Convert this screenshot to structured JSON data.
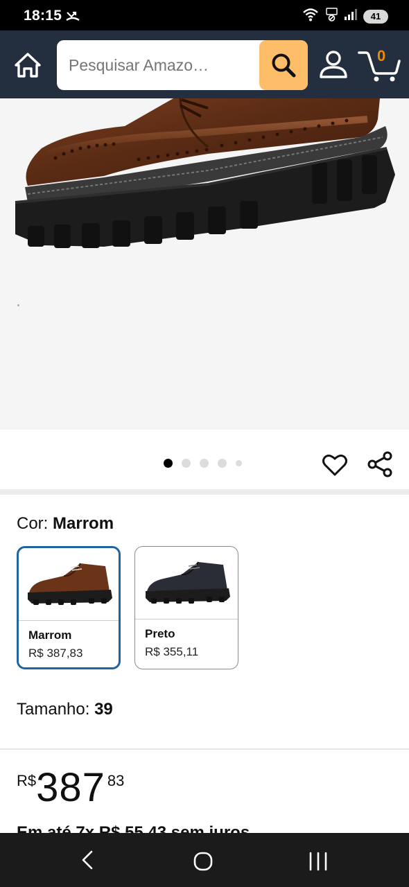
{
  "status_bar": {
    "time": "18:15",
    "battery": "41"
  },
  "header": {
    "search_placeholder": "Pesquisar Amazo…",
    "cart_count": "0"
  },
  "gallery": {
    "image_count": 5,
    "active_index": 0
  },
  "variation": {
    "color_label": "Cor: ",
    "color_value": "Marrom",
    "options": [
      {
        "name": "Marrom",
        "price": "R$ 387,83",
        "selected": true
      },
      {
        "name": "Preto",
        "price": "R$ 355,11",
        "selected": false
      }
    ],
    "size_label": "Tamanho: ",
    "size_value": "39"
  },
  "price": {
    "symbol": "R$",
    "whole": "387",
    "cents": "83",
    "installments": "Em até 7x R$ 55,43 sem juros"
  },
  "colors": {
    "header_bg": "#232f3e",
    "search_button": "#febd69",
    "cart_count": "#f08804",
    "selected_border": "#2162a1"
  }
}
